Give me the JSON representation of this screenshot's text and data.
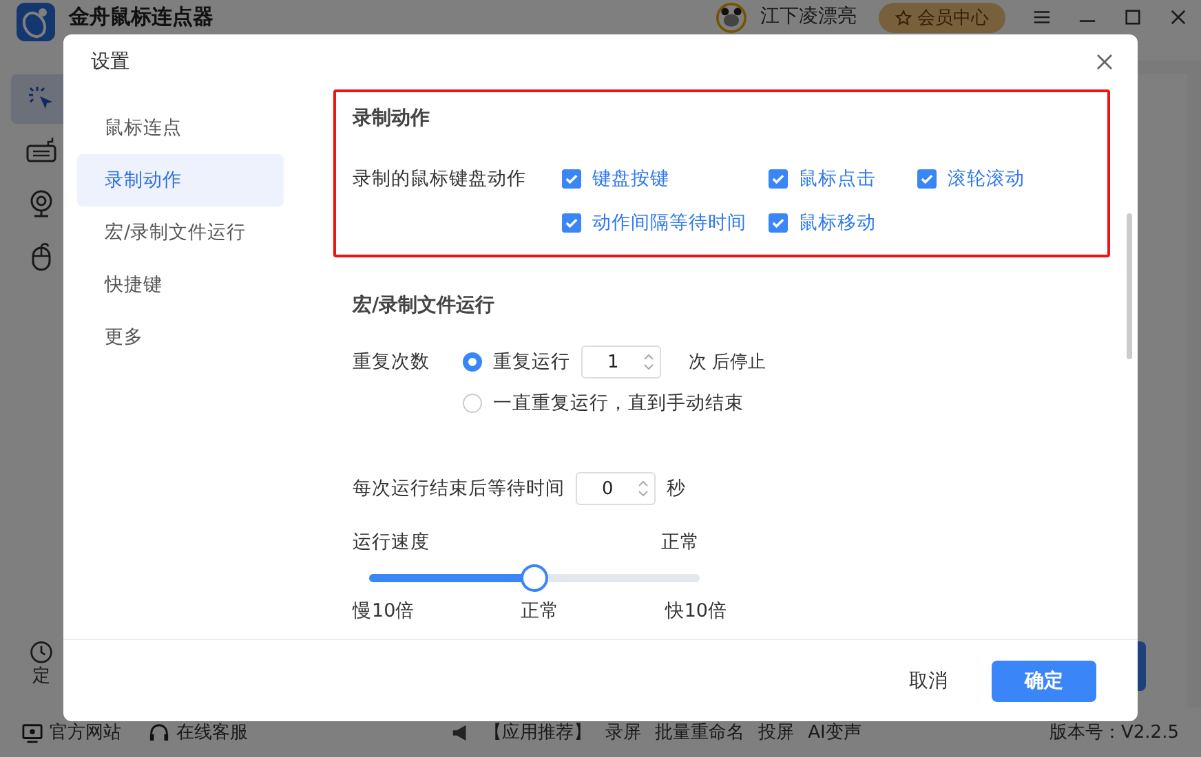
{
  "app": {
    "title": "金舟鼠标连点器",
    "user": "江下凌漂亮",
    "vip_button": "会员中心",
    "sidebar_icons": [
      {
        "kind": "click",
        "selected": true
      },
      {
        "kind": "keyboard",
        "selected": false
      },
      {
        "kind": "webcam",
        "selected": false
      },
      {
        "kind": "mouse",
        "selected": false
      }
    ],
    "timer_label": "定",
    "footer_links": [
      {
        "kind": "monitor",
        "label": "官方网站"
      },
      {
        "kind": "headset",
        "label": "在线客服"
      }
    ],
    "promo_label": "【应用推荐】",
    "promo_items": [
      "录屏",
      "批量重命名",
      "投屏",
      "AI变声"
    ],
    "version": "版本号：V2.2.5"
  },
  "dialog": {
    "title": "设置",
    "nav": [
      {
        "label": "鼠标连点",
        "selected": false
      },
      {
        "label": "录制动作",
        "selected": true
      },
      {
        "label": "宏/录制文件运行",
        "selected": false
      },
      {
        "label": "快捷键",
        "selected": false
      },
      {
        "label": "更多",
        "selected": false
      }
    ],
    "record": {
      "title": "录制动作",
      "highlighted": true,
      "label": "录制的鼠标键盘动作",
      "options": [
        {
          "label": "键盘按键",
          "checked": true
        },
        {
          "label": "鼠标点击",
          "checked": true
        },
        {
          "label": "滚轮滚动",
          "checked": true
        },
        {
          "label": "动作间隔等待时间",
          "checked": true
        },
        {
          "label": "鼠标移动",
          "checked": true
        }
      ]
    },
    "macro": {
      "title": "宏/录制文件运行",
      "repeat_label": "重复次数",
      "repeat_options": [
        {
          "label": "重复运行",
          "selected": true,
          "count": "1",
          "suffix": "次 后停止"
        },
        {
          "label": "一直重复运行，直到手动结束",
          "selected": false
        }
      ],
      "wait_label": "每次运行结束后等待时间",
      "wait_value": "0",
      "wait_unit": "秒",
      "speed_label": "运行速度",
      "speed_value": "正常",
      "speed": {
        "level": 0.5
      },
      "speed_ticks": [
        "慢10倍",
        "正常",
        "快10倍"
      ]
    },
    "cancel": "取消",
    "confirm": "确定"
  }
}
